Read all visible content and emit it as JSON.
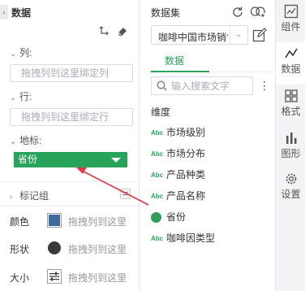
{
  "left_panel": {
    "title": "数据",
    "collapse_glyph": "›",
    "columns_label": "列:",
    "columns_placeholder": "拖拽列到这里绑定列",
    "rows_label": "行:",
    "rows_placeholder": "拖拽列到这里绑定行",
    "geo_label": "地标:",
    "geo_field": "省份",
    "marks_group_label": "标记组",
    "marks": [
      {
        "label": "颜色",
        "hint": "拖拽列到这里",
        "icon": "color-icon"
      },
      {
        "label": "形状",
        "hint": "拖拽列到这里",
        "icon": "shape-icon"
      },
      {
        "label": "大小",
        "hint": "拖拽列到这里",
        "icon": "size-icon"
      }
    ]
  },
  "middle_panel": {
    "title": "数据集",
    "dataset_value": "咖啡中国市场销售",
    "tab_label": "数据",
    "search_placeholder": "输入搜索文字",
    "dimension_title": "维度",
    "abc_glyph": "Abc",
    "fields": [
      {
        "label": "市场级别",
        "type": "text"
      },
      {
        "label": "市场分布",
        "type": "text"
      },
      {
        "label": "产品种类",
        "type": "text"
      },
      {
        "label": "产品名称",
        "type": "text"
      },
      {
        "label": "省份",
        "type": "geo"
      },
      {
        "label": "咖啡因类型",
        "type": "text"
      }
    ]
  },
  "right_sidebar": {
    "items": [
      {
        "label": "组件",
        "icon": "component-icon"
      },
      {
        "label": "数据",
        "icon": "data-icon",
        "active": true
      },
      {
        "label": "格式",
        "icon": "format-icon"
      },
      {
        "label": "图形",
        "icon": "chart-icon"
      },
      {
        "label": "设置",
        "icon": "settings-icon"
      }
    ]
  },
  "colors": {
    "accent": "#27a35a",
    "arrow": "#e0393e",
    "sidebar_bg": "#f2f3f5"
  }
}
